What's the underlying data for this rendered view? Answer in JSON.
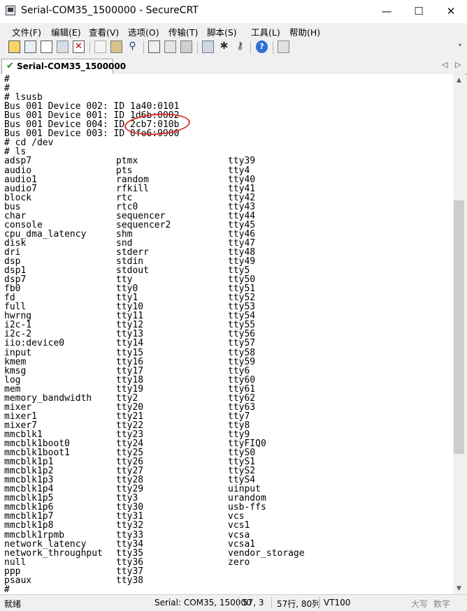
{
  "window": {
    "title": "Serial-COM35_1500000 - SecureCRT"
  },
  "window_controls": {
    "minimize": "—",
    "maximize": "☐",
    "close": "✕"
  },
  "menu": [
    {
      "label": "文件(F)"
    },
    {
      "label": "编辑(E)"
    },
    {
      "label": "查看(V)"
    },
    {
      "label": "选项(O)"
    },
    {
      "label": "传输(T)"
    },
    {
      "label": "脚本(S)"
    },
    {
      "label": "工具(L)"
    },
    {
      "label": "帮助(H)"
    }
  ],
  "toolbar": {
    "icons": [
      "connect-icon",
      "quick-connect-icon",
      "connect-in-tab-icon",
      "reconnect-icon",
      "disconnect-icon",
      "copy-icon",
      "paste-icon",
      "find-icon",
      "print-icon",
      "print-selection-icon",
      "printer-setup-icon",
      "session-options-icon",
      "keymap-icon",
      "sftp-icon",
      "help-icon",
      "about-icon"
    ]
  },
  "tabs": {
    "active_label": "Serial-COM35_1500000",
    "active_status_icon": "connected-check-icon",
    "scroll_left": "◁",
    "scroll_right": "▷"
  },
  "terminal": {
    "highlighted_text": "2cb7:010b",
    "lines": [
      {
        "text": "#"
      },
      {
        "text": "#"
      },
      {
        "text": "# lsusb"
      },
      {
        "text": "Bus 001 Device 002: ID 1a40:0101"
      },
      {
        "text": "Bus 001 Device 001: ID 1d6b:0002"
      },
      {
        "text": "Bus 001 Device 004: ID 2cb7:010b"
      },
      {
        "text": "Bus 001 Device 003: ID 0fe6:9900"
      },
      {
        "text": "# cd /dev"
      },
      {
        "text": "# ls"
      }
    ],
    "listing": [
      [
        "adsp7",
        "ptmx",
        "tty39"
      ],
      [
        "audio",
        "pts",
        "tty4"
      ],
      [
        "audio1",
        "random",
        "tty40"
      ],
      [
        "audio7",
        "rfkill",
        "tty41"
      ],
      [
        "block",
        "rtc",
        "tty42"
      ],
      [
        "bus",
        "rtc0",
        "tty43"
      ],
      [
        "char",
        "sequencer",
        "tty44"
      ],
      [
        "console",
        "sequencer2",
        "tty45"
      ],
      [
        "cpu_dma_latency",
        "shm",
        "tty46"
      ],
      [
        "disk",
        "snd",
        "tty47"
      ],
      [
        "dri",
        "stderr",
        "tty48"
      ],
      [
        "dsp",
        "stdin",
        "tty49"
      ],
      [
        "dsp1",
        "stdout",
        "tty5"
      ],
      [
        "dsp7",
        "tty",
        "tty50"
      ],
      [
        "fb0",
        "tty0",
        "tty51"
      ],
      [
        "fd",
        "tty1",
        "tty52"
      ],
      [
        "full",
        "tty10",
        "tty53"
      ],
      [
        "hwrng",
        "tty11",
        "tty54"
      ],
      [
        "i2c-1",
        "tty12",
        "tty55"
      ],
      [
        "i2c-2",
        "tty13",
        "tty56"
      ],
      [
        "iio:device0",
        "tty14",
        "tty57"
      ],
      [
        "input",
        "tty15",
        "tty58"
      ],
      [
        "kmem",
        "tty16",
        "tty59"
      ],
      [
        "kmsg",
        "tty17",
        "tty6"
      ],
      [
        "log",
        "tty18",
        "tty60"
      ],
      [
        "mem",
        "tty19",
        "tty61"
      ],
      [
        "memory_bandwidth",
        "tty2",
        "tty62"
      ],
      [
        "mixer",
        "tty20",
        "tty63"
      ],
      [
        "mixer1",
        "tty21",
        "tty7"
      ],
      [
        "mixer7",
        "tty22",
        "tty8"
      ],
      [
        "mmcblk1",
        "tty23",
        "tty9"
      ],
      [
        "mmcblk1boot0",
        "tty24",
        "ttyFIQ0"
      ],
      [
        "mmcblk1boot1",
        "tty25",
        "ttyS0"
      ],
      [
        "mmcblk1p1",
        "tty26",
        "ttyS1"
      ],
      [
        "mmcblk1p2",
        "tty27",
        "ttyS2"
      ],
      [
        "mmcblk1p3",
        "tty28",
        "ttyS4"
      ],
      [
        "mmcblk1p4",
        "tty29",
        "uinput"
      ],
      [
        "mmcblk1p5",
        "tty3",
        "urandom"
      ],
      [
        "mmcblk1p6",
        "tty30",
        "usb-ffs"
      ],
      [
        "mmcblk1p7",
        "tty31",
        "vcs"
      ],
      [
        "mmcblk1p8",
        "tty32",
        "vcs1"
      ],
      [
        "mmcblk1rpmb",
        "tty33",
        "vcsa"
      ],
      [
        "network_latency",
        "tty34",
        "vcsa1"
      ],
      [
        "network_throughput",
        "tty35",
        "vendor_storage"
      ],
      [
        "null",
        "tty36",
        "zero"
      ],
      [
        "ppp",
        "tty37",
        ""
      ],
      [
        "psaux",
        "tty38",
        ""
      ]
    ],
    "prompt_line": "#"
  },
  "scrollbar": {
    "up": "▲",
    "down": "▼",
    "position": 0.47
  },
  "statusbar": {
    "state": "就绪",
    "connection": "Serial: COM35, 150000",
    "cursor": "57,  3",
    "size": "57行, 80列",
    "emulation": "VT100",
    "caps": "大写",
    "num": "数字"
  },
  "colors": {
    "highlight": "#d9322b",
    "connected": "#1f8a2a"
  }
}
